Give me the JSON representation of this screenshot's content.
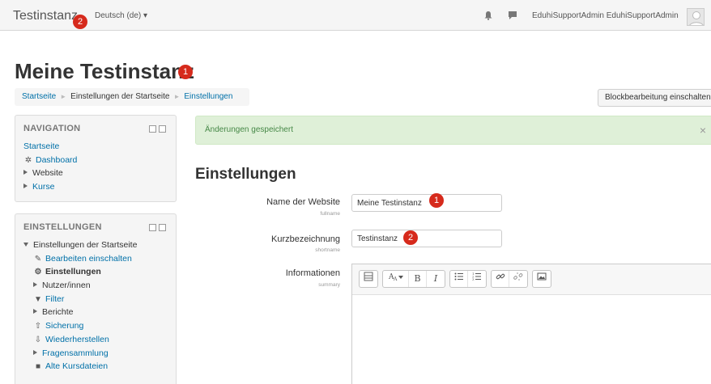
{
  "navbar": {
    "brand": "Testinstanz",
    "badge": "2",
    "language": "Deutsch (de)",
    "language_caret": "▾",
    "username": "EduhiSupportAdmin EduhiSupportAdmin"
  },
  "header": {
    "title": "Meine Testinstanz",
    "badge": "1",
    "breadcrumb": {
      "home": "Startseite",
      "separator": "►",
      "middle": "Einstellungen der Startseite",
      "current": "Einstellungen"
    },
    "block_button": "Blockbearbeitung einschalten"
  },
  "navigation_block": {
    "title": "NAVIGATION",
    "items": {
      "home": "Startseite",
      "dashboard": "Dashboard",
      "website": "Website",
      "courses": "Kurse"
    }
  },
  "settings_block": {
    "title": "EINSTELLUNGEN",
    "items": {
      "frontpage_settings": "Einstellungen der Startseite",
      "edit_on": "Bearbeiten einschalten",
      "settings": "Einstellungen",
      "users": "Nutzer/innen",
      "filter": "Filter",
      "reports": "Berichte",
      "backup": "Sicherung",
      "restore": "Wiederherstellen",
      "question_bank": "Fragensammlung",
      "legacy_files": "Alte Kursdateien"
    }
  },
  "alert": {
    "message": "Änderungen gespeichert",
    "close": "×"
  },
  "form": {
    "title": "Einstellungen",
    "fullname": {
      "label": "Name der Website",
      "sub": "fullname",
      "value": "Meine Testinstanz",
      "badge": "1"
    },
    "shortname": {
      "label": "Kurzbezeichnung",
      "sub": "shortname",
      "value": "Testinstanz",
      "badge": "2"
    },
    "summary": {
      "label": "Informationen",
      "sub": "summary"
    }
  },
  "editor_toolbar": {
    "bold": "B",
    "italic": "I"
  },
  "colors": {
    "link": "#0070a8",
    "badge": "#d62a1c",
    "alert_bg": "#dff0d8",
    "alert_text": "#468847"
  }
}
